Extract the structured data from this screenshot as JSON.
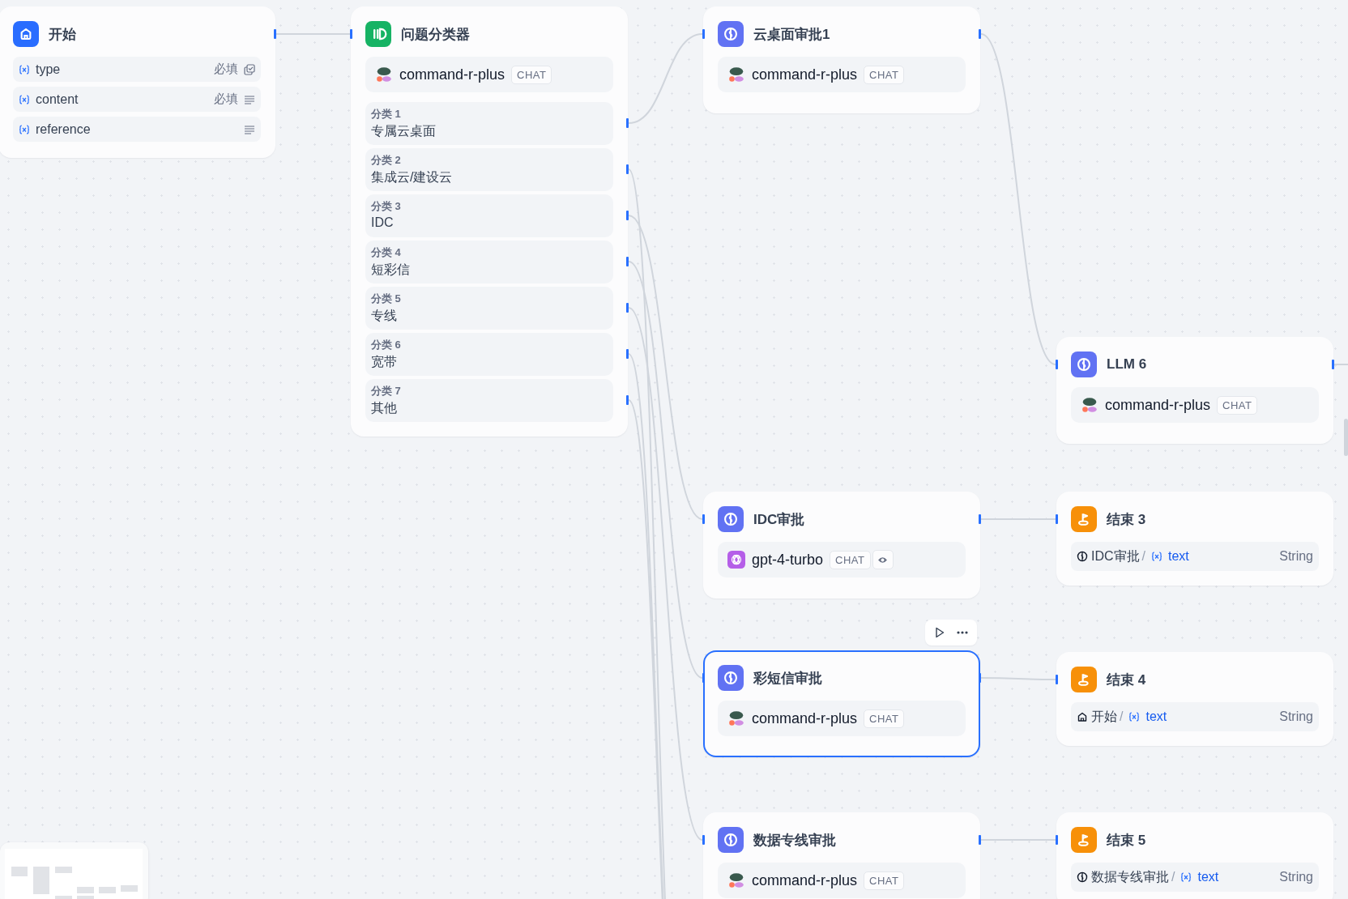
{
  "nodes": [
    {
      "kind": "start",
      "title": "开始",
      "selected": false,
      "variables": [
        {
          "name": "type",
          "required": "必填",
          "kind": "select"
        },
        {
          "name": "content",
          "required": "必填",
          "kind": "paragraph"
        },
        {
          "name": "reference",
          "kind": "paragraph"
        }
      ]
    },
    {
      "kind": "classifier",
      "title": "问题分类器",
      "selected": false,
      "model": {
        "kind": "blob",
        "name": "command-r-plus",
        "mode": "CHAT",
        "vision": false
      },
      "classes": [
        {
          "label": "分类 1",
          "text": "专属云桌面"
        },
        {
          "label": "分类 2",
          "text": "集成云/建设云"
        },
        {
          "label": "分类 3",
          "text": "IDC"
        },
        {
          "label": "分类 4",
          "text": "短彩信"
        },
        {
          "label": "分类 5",
          "text": "专线"
        },
        {
          "label": "分类 6",
          "text": "宽带"
        },
        {
          "label": "分类 7",
          "text": "其他"
        }
      ]
    },
    {
      "kind": "llm",
      "title": "云桌面审批1",
      "selected": false,
      "model": {
        "kind": "blob",
        "name": "command-r-plus",
        "mode": "CHAT",
        "vision": false
      }
    },
    {
      "kind": "llm",
      "title": "LLM 6",
      "selected": false,
      "model": {
        "kind": "blob",
        "name": "command-r-plus",
        "mode": "CHAT",
        "vision": false
      }
    },
    {
      "kind": "llm",
      "title": "IDC审批",
      "selected": false,
      "model": {
        "kind": "knot",
        "name": "gpt-4-turbo",
        "mode": "CHAT",
        "vision": true
      }
    },
    {
      "kind": "end",
      "title": "结束 3",
      "selected": false,
      "output": {
        "kind": "llm",
        "source": "IDC审批",
        "separator": "/",
        "variable": "text",
        "type": "String"
      }
    },
    {
      "kind": "llm",
      "title": "彩短信审批",
      "selected": true,
      "model": {
        "kind": "blob",
        "name": "command-r-plus",
        "mode": "CHAT",
        "vision": false
      }
    },
    {
      "kind": "end",
      "title": "结束 4",
      "selected": false,
      "output": {
        "kind": "start",
        "source": "开始",
        "separator": "/",
        "variable": "text",
        "type": "String"
      }
    },
    {
      "kind": "llm",
      "title": "数据专线审批",
      "selected": false,
      "model": {
        "kind": "blob",
        "name": "command-r-plus",
        "mode": "CHAT",
        "vision": false
      }
    },
    {
      "kind": "end",
      "title": "结束 5",
      "selected": false,
      "output": {
        "kind": "llm",
        "source": "数据专线审批",
        "separator": "/",
        "variable": "text",
        "type": "String"
      }
    }
  ]
}
